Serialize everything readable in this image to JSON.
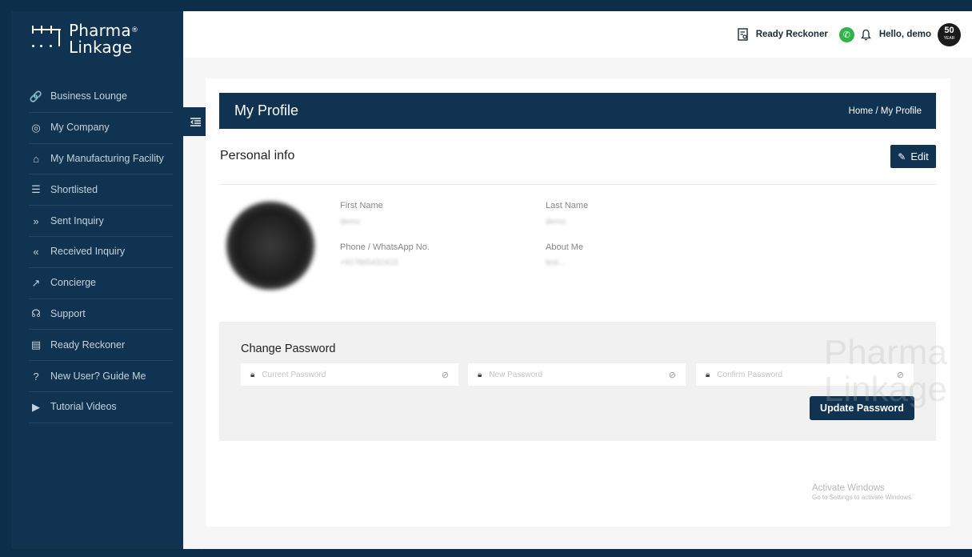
{
  "brand": {
    "line1": "Pharma",
    "line2": "Linkage",
    "reg": "®"
  },
  "sidebar": {
    "items": [
      {
        "label": "Business Lounge",
        "icon": "link-icon",
        "glyph": "🔗"
      },
      {
        "label": "My Company",
        "icon": "location-pin-icon",
        "glyph": "◎"
      },
      {
        "label": "My Manufacturing Facility",
        "icon": "home-icon",
        "glyph": "⌂"
      },
      {
        "label": "Shortlisted",
        "icon": "list-icon",
        "glyph": "☰"
      },
      {
        "label": "Sent Inquiry",
        "icon": "double-chevron-right-icon",
        "glyph": "»"
      },
      {
        "label": "Received Inquiry",
        "icon": "double-chevron-left-icon",
        "glyph": "«"
      },
      {
        "label": "Concierge",
        "icon": "trend-icon",
        "glyph": "↗"
      },
      {
        "label": "Support",
        "icon": "headset-icon",
        "glyph": "☊"
      },
      {
        "label": "Ready Reckoner",
        "icon": "document-search-icon",
        "glyph": "▤"
      },
      {
        "label": "New User? Guide Me",
        "icon": "help-circle-icon",
        "glyph": "?"
      },
      {
        "label": "Tutorial Videos",
        "icon": "video-play-icon",
        "glyph": "▶"
      }
    ]
  },
  "header": {
    "ready_reckoner": "Ready Reckoner",
    "greeting": "Hello, demo",
    "badge_number": "50",
    "badge_sub": "YEAR"
  },
  "page": {
    "title": "My Profile",
    "breadcrumb": "Home / My Profile"
  },
  "profile": {
    "section_title": "Personal info",
    "edit_label": "Edit",
    "first_name_label": "First Name",
    "first_name_value": "demo",
    "last_name_label": "Last Name",
    "last_name_value": "demo",
    "phone_label": "Phone / WhatsApp No.",
    "phone_value": "+917865432415",
    "about_label": "About Me",
    "about_value": "test..."
  },
  "password": {
    "title": "Change Password",
    "current_placeholder": "Current Password",
    "new_placeholder": "New Password",
    "confirm_placeholder": "Confirm Password",
    "update_label": "Update Password"
  },
  "watermark": {
    "line1": "Pharma",
    "line2": "Linkage"
  },
  "os_notice": {
    "line1": "Activate Windows",
    "line2": "Go to Settings to activate Windows."
  },
  "colors": {
    "navy": "#0f3350",
    "whatsapp": "#2fb34a"
  }
}
